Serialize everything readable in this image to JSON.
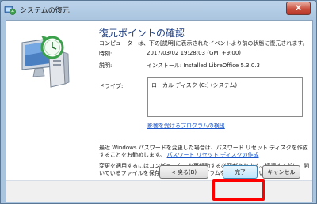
{
  "window": {
    "title": "システムの復元",
    "close_label": "X"
  },
  "page": {
    "heading": "復元ポイントの確認",
    "subtitle": "コンピューターは、下の[説明]に表示されたイベントより前の状態に復元されます。",
    "time_label": "時刻:",
    "time_value": "2017/03/02 19:28:03 (GMT+9:00)",
    "desc_label": "説明:",
    "desc_value": "インストール: Installed LibreOffice 5.3.0.3",
    "drive_label": "ドライブ:",
    "drives": [
      "ローカル ディスク (C:) (システム)"
    ],
    "scan_link": "影響を受けるプログラムの検出",
    "note1_text": "最近 Windows パスワードを変更した場合は、パスワード リセット ディスクを作成することをお勧めします。",
    "note1_link": "パスワード リセット ディスクの作成",
    "note2_text": "変更を適用するにはコンピューターを再起動する必要があります。続行する前に、開いているファイルを保存し、すべてのプログラムを閉じてください。"
  },
  "buttons": {
    "back": "< 戻る(B)",
    "finish": "完了",
    "cancel": "キャンセル"
  },
  "colors": {
    "heading": "#1e3f83",
    "link": "#1a55c9",
    "highlight": "#ff0000"
  },
  "icons": [
    "system-restore-icon",
    "close-icon",
    "restore-illustration-icon"
  ]
}
